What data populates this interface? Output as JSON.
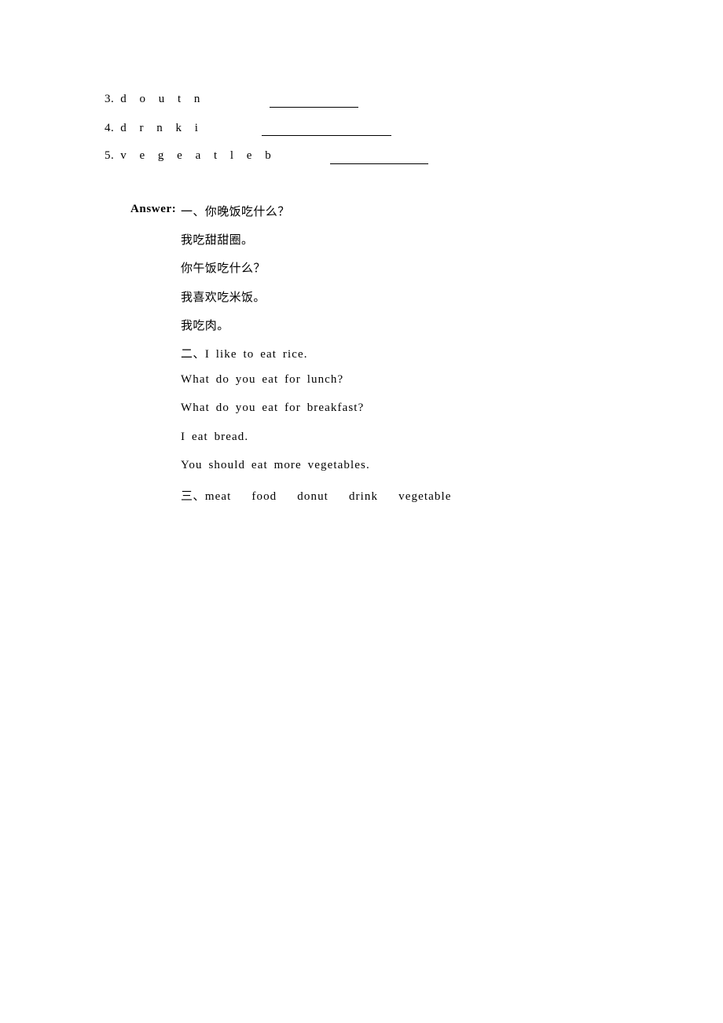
{
  "document": {
    "page_background": "#ffffff",
    "text_color": "#000000"
  },
  "exercise": {
    "items": [
      {
        "number": "3.",
        "letters": "d o u t n",
        "blank": true
      },
      {
        "number": "4.",
        "letters": "d r n k i",
        "blank": true
      },
      {
        "number": "5.",
        "letters": "v e g e a t l e b",
        "blank": true
      }
    ]
  },
  "answers": {
    "label": "Answer:",
    "lines": [
      {
        "kind": "cjk",
        "text": "一、你晚饭吃什么？"
      },
      {
        "kind": "cjk",
        "text": "我吃甜甜圈。"
      },
      {
        "kind": "cjk",
        "text": "你午饭吃什么？"
      },
      {
        "kind": "cjk",
        "text": "我喜欢吃米饭。"
      },
      {
        "kind": "cjk",
        "text": "我吃肉。"
      },
      {
        "kind": "mixed",
        "marker": "二、",
        "text": "I like to eat rice."
      },
      {
        "kind": "latin",
        "text": "What do you eat for lunch?"
      },
      {
        "kind": "latin",
        "text": "What do you eat for breakfast?"
      },
      {
        "kind": "latin",
        "text": "I eat bread."
      },
      {
        "kind": "latin",
        "text": "You should eat more vegetables."
      }
    ],
    "word_list": {
      "marker": "三、",
      "words": [
        "meat",
        "food",
        "donut",
        "drink",
        "vegetable"
      ]
    }
  }
}
